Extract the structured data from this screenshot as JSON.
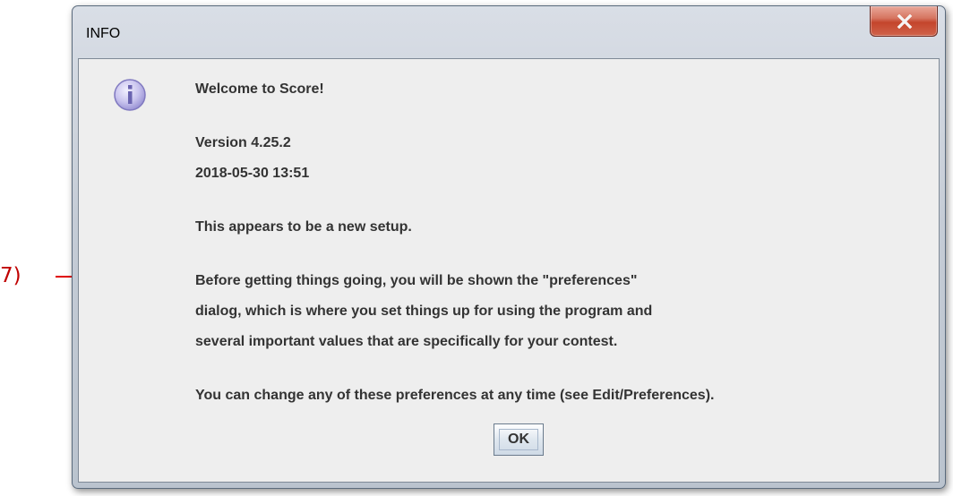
{
  "annotation": {
    "step_label": "7)",
    "arrow_color": "#e00000"
  },
  "window": {
    "title": "INFO",
    "close_icon": "close-x-icon",
    "close_color": "#c4452c"
  },
  "dialog": {
    "icon": "info-icon",
    "lines": [
      "Welcome to Score!",
      "Version 4.25.2",
      "2018-05-30 13:51",
      "This appears to be a new setup.",
      "Before getting things going, you will be shown the \"preferences\"",
      "dialog, which is where you set things up for using the program and",
      "several important values that are specifically for your contest.",
      "You can change any of these preferences at any time (see Edit/Preferences)."
    ],
    "ok_label": "OK"
  }
}
